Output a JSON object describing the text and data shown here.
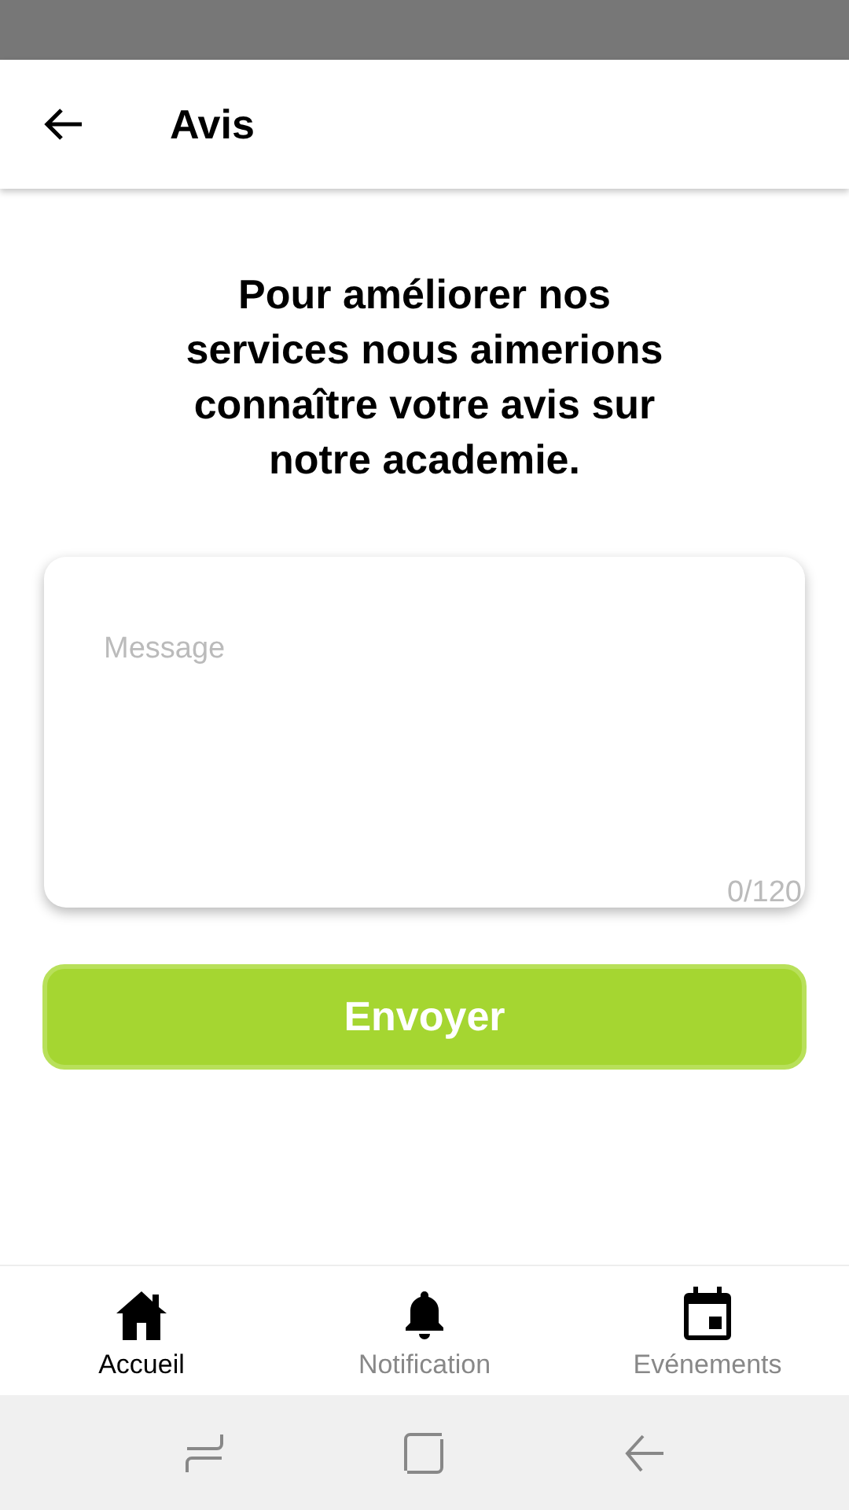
{
  "app_bar": {
    "title": "Avis"
  },
  "intro": "Pour améliorer nos services nous aimerions connaître votre avis sur notre academie.",
  "message": {
    "placeholder": "Message",
    "counter": "0/120"
  },
  "submit_button": "Envoyer",
  "bottom_nav": [
    {
      "label": "Accueil",
      "kind": "home",
      "selected": true
    },
    {
      "label": "Notification",
      "kind": "bell",
      "selected": false
    },
    {
      "label": "Evénements",
      "kind": "calendar",
      "selected": false
    }
  ]
}
